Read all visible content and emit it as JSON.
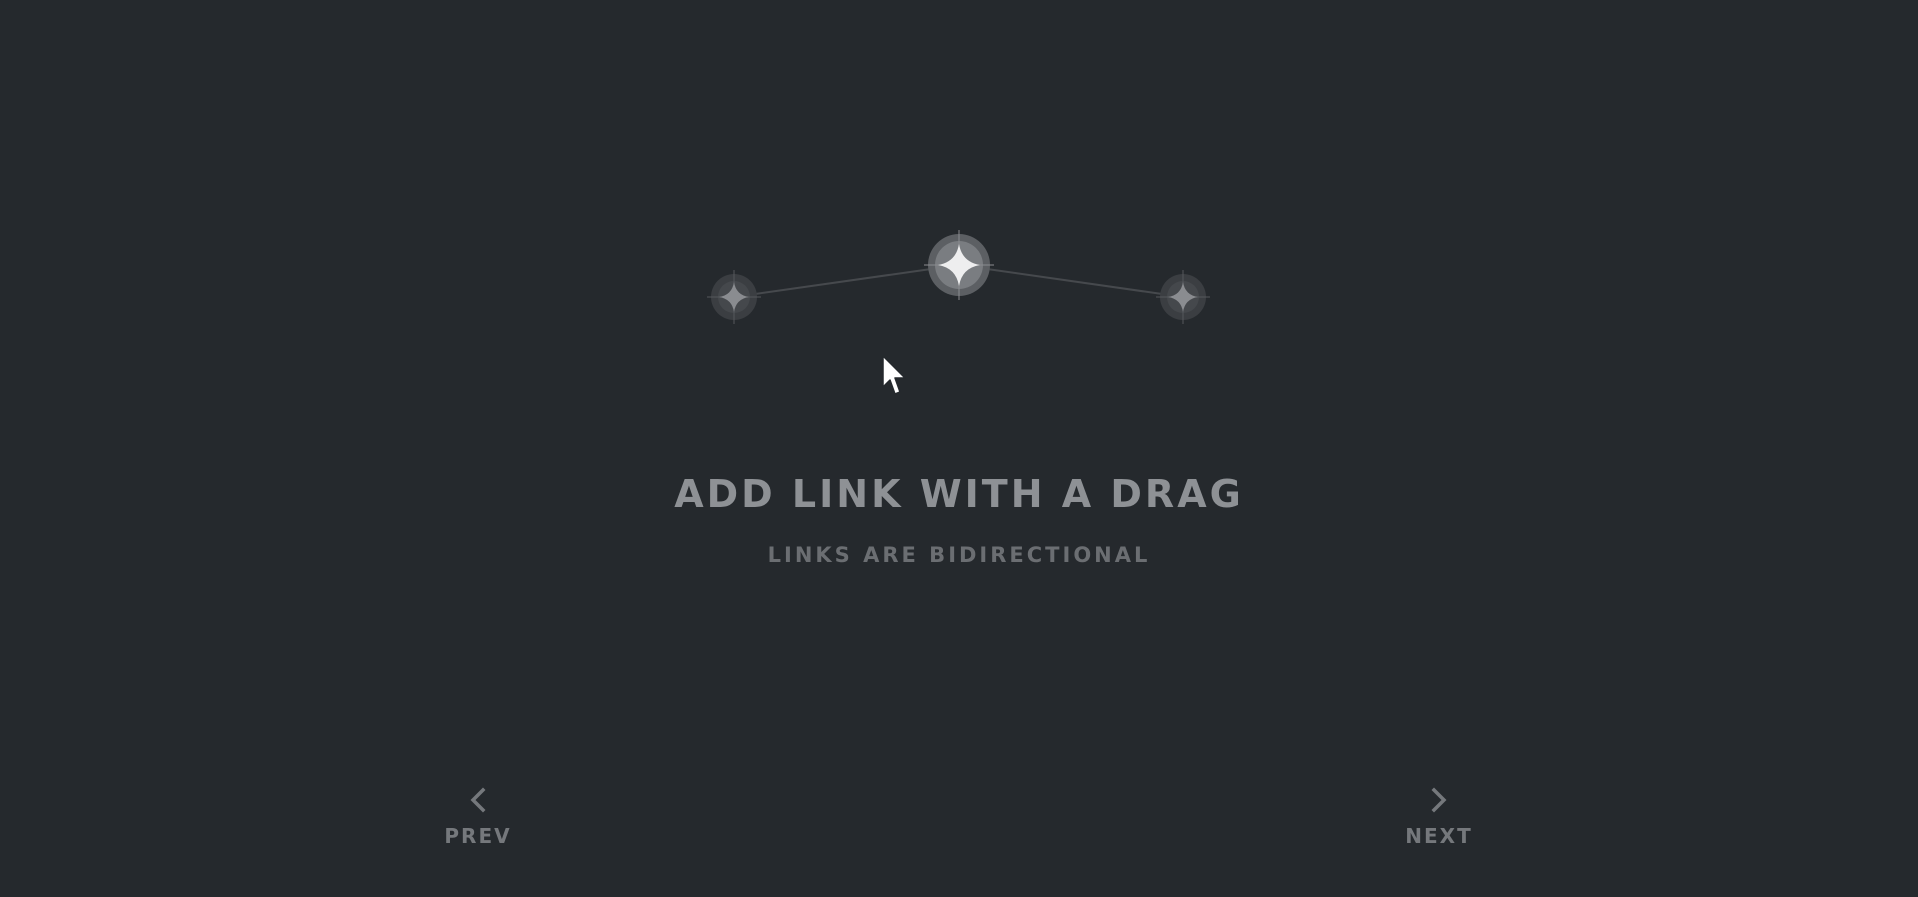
{
  "tutorial": {
    "title": "ADD LINK WITH A DRAG",
    "subtitle": "LINKS ARE BIDIRECTIONAL"
  },
  "navigation": {
    "prev_label": "PREV",
    "next_label": "NEXT"
  },
  "diagram": {
    "nodes": [
      {
        "name": "left-star",
        "state": "dim"
      },
      {
        "name": "center-star",
        "state": "highlighted"
      },
      {
        "name": "right-star",
        "state": "dim"
      }
    ],
    "links": [
      {
        "from": "left-star",
        "to": "center-star"
      },
      {
        "from": "center-star",
        "to": "right-star"
      }
    ]
  },
  "icons": {
    "prev": "chevron-left-icon",
    "next": "chevron-right-icon",
    "pointer": "mouse-cursor-icon",
    "node": "four-point-star-icon"
  },
  "colors": {
    "background": "#25292d",
    "title": "#8e9195",
    "subtitle": "#6b6e72",
    "nav": "#75787c",
    "link": "#46494d",
    "node_glow": "#8a8c90",
    "node_core": "#e6e7e8"
  }
}
